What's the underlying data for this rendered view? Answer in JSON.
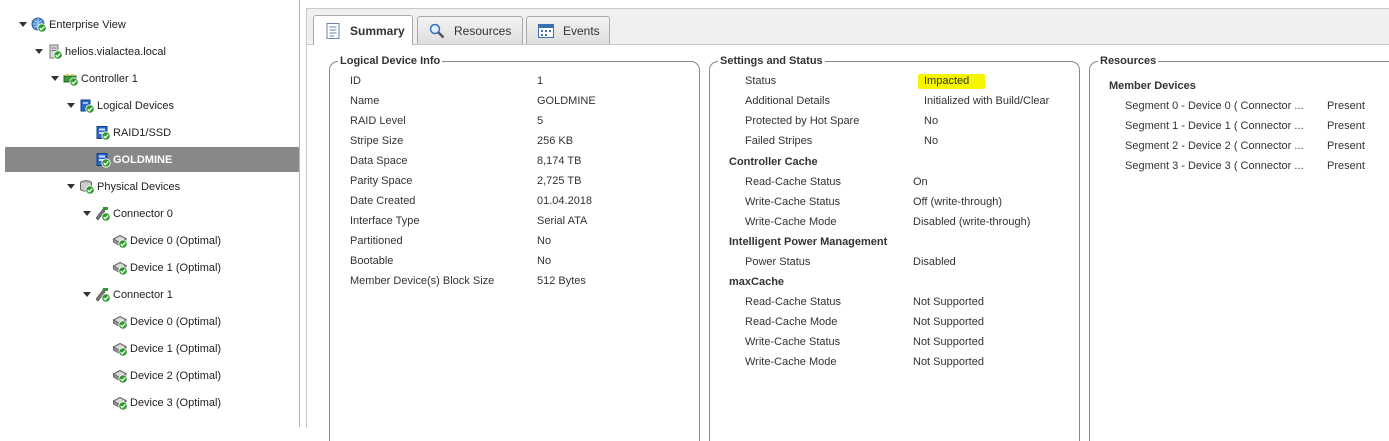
{
  "tree": [
    {
      "label": "Enterprise View",
      "icon": "enterprise-icon",
      "level": 0,
      "open": true
    },
    {
      "label": "helios.vialactea.local",
      "icon": "server-icon",
      "level": 1,
      "open": true
    },
    {
      "label": "Controller 1",
      "icon": "controller-icon",
      "level": 2,
      "open": true
    },
    {
      "label": "Logical Devices",
      "icon": "logical-devices-icon",
      "level": 3,
      "open": true
    },
    {
      "label": "RAID1/SSD",
      "icon": "logical-drive-icon",
      "level": 4,
      "open": false
    },
    {
      "label": "GOLDMINE",
      "icon": "logical-drive-icon",
      "level": 4,
      "open": false,
      "selected": true
    },
    {
      "label": "Physical Devices",
      "icon": "physical-devices-icon",
      "level": 3,
      "open": true
    },
    {
      "label": "Connector 0",
      "icon": "connector-icon",
      "level": 4,
      "open": true
    },
    {
      "label": "Device 0 (Optimal)",
      "icon": "disk-icon",
      "level": 5,
      "open": false
    },
    {
      "label": "Device 1 (Optimal)",
      "icon": "disk-icon",
      "level": 5,
      "open": false
    },
    {
      "label": "Connector 1",
      "icon": "connector-icon",
      "level": 4,
      "open": true
    },
    {
      "label": "Device 0 (Optimal)",
      "icon": "disk-icon",
      "level": 5,
      "open": false
    },
    {
      "label": "Device 1 (Optimal)",
      "icon": "disk-icon",
      "level": 5,
      "open": false
    },
    {
      "label": "Device 2 (Optimal)",
      "icon": "disk-icon",
      "level": 5,
      "open": false
    },
    {
      "label": "Device 3 (Optimal)",
      "icon": "disk-icon",
      "level": 5,
      "open": false
    }
  ],
  "tabs": [
    {
      "label": "Summary",
      "icon": "document-icon",
      "active": true
    },
    {
      "label": "Resources",
      "icon": "magnifier-icon",
      "active": false
    },
    {
      "label": "Events",
      "icon": "calendar-icon",
      "active": false
    }
  ],
  "logical": {
    "title": "Logical Device Info",
    "rows": [
      [
        "ID",
        "1"
      ],
      [
        "Name",
        "GOLDMINE"
      ],
      [
        "RAID Level",
        "5"
      ],
      [
        "Stripe Size",
        "256 KB"
      ],
      [
        "Data Space",
        "8,174 TB"
      ],
      [
        "Parity Space",
        "2,725 TB"
      ],
      [
        "Date Created",
        "01.04.2018"
      ],
      [
        "Interface Type",
        "Serial ATA"
      ],
      [
        "Partitioned",
        "No"
      ],
      [
        "Bootable",
        "No"
      ],
      [
        "Member Device(s) Block Size",
        "512 Bytes"
      ]
    ]
  },
  "settings": {
    "title": "Settings and Status",
    "status_rows": [
      [
        "Status",
        "Impacted"
      ],
      [
        "Additional Details",
        "Initialized with Build/Clear"
      ],
      [
        "Protected by Hot Spare",
        "No"
      ],
      [
        "Failed Stripes",
        "No"
      ]
    ],
    "sections": [
      {
        "title": "Controller Cache",
        "rows": [
          [
            "Read-Cache Status",
            "On"
          ],
          [
            "Write-Cache Status",
            "Off (write-through)"
          ],
          [
            "Write-Cache Mode",
            "Disabled (write-through)"
          ]
        ]
      },
      {
        "title": "Intelligent Power Management",
        "rows": [
          [
            "Power Status",
            "Disabled"
          ]
        ]
      },
      {
        "title": "maxCache",
        "rows": [
          [
            "Read-Cache Status",
            "Not Supported"
          ],
          [
            "Read-Cache Mode",
            "Not Supported"
          ],
          [
            "Write-Cache Status",
            "Not Supported"
          ],
          [
            "Write-Cache Mode",
            "Not Supported"
          ]
        ]
      }
    ]
  },
  "resources": {
    "title": "Resources",
    "subtitle": "Member Devices",
    "rows": [
      [
        "Segment 0 - Device 0 ( Connector ...",
        "Present"
      ],
      [
        "Segment 1 - Device 1 ( Connector ...",
        "Present"
      ],
      [
        "Segment 2 - Device 2 ( Connector ...",
        "Present"
      ],
      [
        "Segment 3 - Device 3 ( Connector ...",
        "Present"
      ]
    ]
  },
  "colors": {
    "highlight": "#f5f500",
    "selected_row": "#888888",
    "ok_green": "#2e9a2e"
  }
}
